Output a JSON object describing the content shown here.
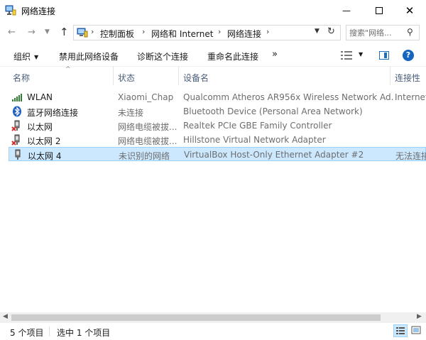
{
  "window": {
    "title": "网络连接"
  },
  "addressbar": {
    "crumbs": [
      "控制面板",
      "网络和 Internet",
      "网络连接"
    ],
    "search_placeholder": "搜索\"网络..."
  },
  "toolbar": {
    "organize": "组织",
    "disable": "禁用此网络设备",
    "diagnose": "诊断这个连接",
    "rename": "重命名此连接",
    "more": "»"
  },
  "columns": [
    "名称",
    "状态",
    "设备名",
    "连接性"
  ],
  "rows": [
    {
      "name": "WLAN",
      "status": "Xiaomi_Chap",
      "device": "Qualcomm Atheros AR956x Wireless Network Ad...",
      "connectivity": "Internet",
      "icon": "wifi-signal-icon",
      "selected": false
    },
    {
      "name": "蓝牙网络连接",
      "status": "未连接",
      "device": "Bluetooth Device (Personal Area Network)",
      "connectivity": "",
      "icon": "bluetooth-icon",
      "selected": false
    },
    {
      "name": "以太网",
      "status": "网络电缆被拔...",
      "device": "Realtek PCIe GBE Family Controller",
      "connectivity": "",
      "icon": "ethernet-disconnected-icon",
      "selected": false
    },
    {
      "name": "以太网 2",
      "status": "网络电缆被拔...",
      "device": "Hillstone Virtual Network Adapter",
      "connectivity": "",
      "icon": "ethernet-disconnected-icon",
      "selected": false
    },
    {
      "name": "以太网 4",
      "status": "未识别的网络",
      "device": "VirtualBox Host-Only Ethernet Adapter #2",
      "connectivity": "无法连接",
      "icon": "ethernet-icon",
      "selected": true
    }
  ],
  "status": {
    "count": "5 个项目",
    "selected": "选中 1 个项目"
  },
  "colors": {
    "selection_bg": "#cce8ff",
    "selection_border": "#99d1ff",
    "accent": "#1565c0"
  }
}
